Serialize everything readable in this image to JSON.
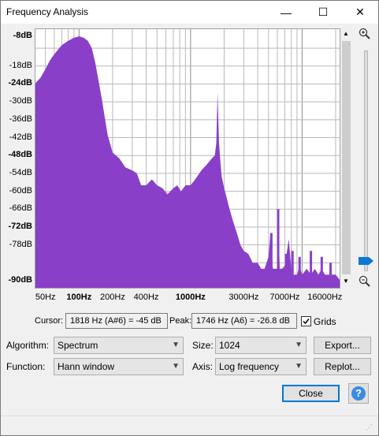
{
  "window": {
    "title": "Frequency Analysis",
    "minimize": "—",
    "maximize": "☐",
    "close": "✕"
  },
  "y_axis_labels": [
    {
      "text": "-8dB",
      "bold": true
    },
    {
      "text": "-18dB",
      "bold": false
    },
    {
      "text": "-24dB",
      "bold": true
    },
    {
      "text": "-30dB",
      "bold": false
    },
    {
      "text": "-36dB",
      "bold": false
    },
    {
      "text": "-42dB",
      "bold": false
    },
    {
      "text": "-48dB",
      "bold": true
    },
    {
      "text": "-54dB",
      "bold": false
    },
    {
      "text": "-60dB",
      "bold": false
    },
    {
      "text": "-66dB",
      "bold": false
    },
    {
      "text": "-72dB",
      "bold": true
    },
    {
      "text": "-78dB",
      "bold": false
    },
    {
      "text": "-90dB",
      "bold": true
    }
  ],
  "x_axis_labels": [
    {
      "text": "50Hz",
      "bold": false
    },
    {
      "text": "100Hz",
      "bold": true
    },
    {
      "text": "200Hz",
      "bold": false
    },
    {
      "text": "400Hz",
      "bold": false
    },
    {
      "text": "1000Hz",
      "bold": true
    },
    {
      "text": "3000Hz",
      "bold": false
    },
    {
      "text": "7000Hz",
      "bold": false
    },
    {
      "text": "16000Hz",
      "bold": false
    }
  ],
  "cursor": {
    "label": "Cursor:",
    "value": "1818 Hz (A#6) = -45 dB"
  },
  "peak": {
    "label": "Peak:",
    "value": "1746 Hz (A6) = -26.8 dB"
  },
  "grids": {
    "label": "Grids",
    "checked": true
  },
  "algorithm": {
    "label": "Algorithm:",
    "value": "Spectrum"
  },
  "size": {
    "label": "Size:",
    "value": "1024"
  },
  "function": {
    "label": "Function:",
    "value": "Hann window"
  },
  "axis": {
    "label": "Axis:",
    "value": "Log frequency"
  },
  "buttons": {
    "export": "Export...",
    "replot": "Replot...",
    "close": "Close",
    "help": "?"
  },
  "colors": {
    "spectrum": "#8a3fc9",
    "plot_bg": "#ffffff",
    "grid": "#b9b9b9"
  },
  "chart_data": {
    "type": "area",
    "x_unit": "Hz",
    "y_unit": "dB",
    "xlim": [
      40,
      22050
    ],
    "ylim": [
      -90,
      -8
    ],
    "x_scale": "log",
    "grid": true,
    "x": [
      40,
      45,
      50,
      55,
      60,
      70,
      80,
      90,
      100,
      110,
      120,
      130,
      140,
      160,
      180,
      200,
      230,
      260,
      300,
      330,
      360,
      400,
      450,
      500,
      560,
      620,
      700,
      760,
      820,
      900,
      1000,
      1100,
      1250,
      1400,
      1550,
      1650,
      1700,
      1746,
      1800,
      1850,
      1900,
      2000,
      2100,
      2200,
      2400,
      2600,
      2800,
      3000,
      3300,
      3600,
      4000,
      4300,
      4600,
      4800,
      5000,
      5200,
      5300,
      5500,
      6000,
      6100,
      6300,
      6600,
      7000,
      7200,
      7600,
      8000,
      8200,
      9000,
      9500,
      10000,
      11000,
      12000,
      13000,
      14000,
      15000,
      16000,
      17000,
      18000,
      20000,
      22050
    ],
    "y": [
      -24,
      -22,
      -19,
      -16,
      -14,
      -11,
      -9.5,
      -8.5,
      -8,
      -8.5,
      -9.5,
      -12,
      -17,
      -29,
      -41,
      -47,
      -49,
      -52,
      -53,
      -54,
      -58,
      -58,
      -56,
      -58,
      -59,
      -61,
      -59,
      -58,
      -60,
      -58,
      -58,
      -56,
      -53,
      -51,
      -49,
      -48,
      -44,
      -27,
      -44,
      -50,
      -55,
      -59,
      -62,
      -65,
      -70,
      -74,
      -78,
      -80,
      -81,
      -84,
      -84,
      -86,
      -86,
      -84,
      -82,
      -74,
      -84,
      -86,
      -86,
      -66,
      -86,
      -86,
      -85,
      -82,
      -76,
      -86,
      -88,
      -88,
      -85,
      -88,
      -86,
      -88,
      -86,
      -88,
      -86,
      -88,
      -88,
      -88,
      -88,
      -90
    ],
    "spikes": [
      {
        "x": 5300,
        "y": -74
      },
      {
        "x": 6100,
        "y": -66
      },
      {
        "x": 7200,
        "y": -81
      },
      {
        "x": 8200,
        "y": -80
      },
      {
        "x": 9500,
        "y": -82
      },
      {
        "x": 12000,
        "y": -80
      },
      {
        "x": 15000,
        "y": -82
      },
      {
        "x": 18000,
        "y": -84
      }
    ]
  }
}
